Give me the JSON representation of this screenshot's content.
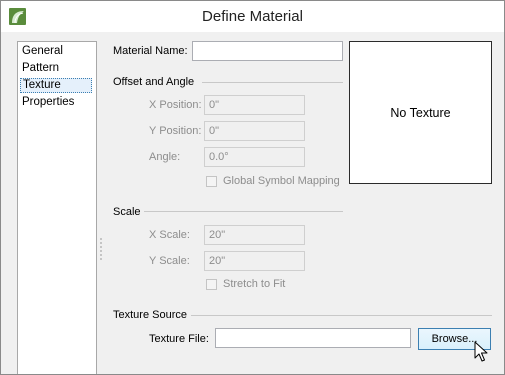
{
  "window": {
    "title": "Define Material",
    "app_icon": "app-logo-icon"
  },
  "nav": {
    "items": [
      {
        "label": "General",
        "selected": false
      },
      {
        "label": "Pattern",
        "selected": false
      },
      {
        "label": "Texture",
        "selected": true
      },
      {
        "label": "Properties",
        "selected": false
      }
    ]
  },
  "material_name": {
    "label": "Material Name:",
    "value": ""
  },
  "offset_angle": {
    "title": "Offset and Angle",
    "x_position": {
      "label": "X Position:",
      "value": "0\""
    },
    "y_position": {
      "label": "Y Position:",
      "value": "0\""
    },
    "angle": {
      "label": "Angle:",
      "value": "0.0°"
    },
    "global_symbol_mapping": {
      "label": "Global Symbol Mapping",
      "checked": false
    }
  },
  "scale": {
    "title": "Scale",
    "x_scale": {
      "label": "X Scale:",
      "value": "20\""
    },
    "y_scale": {
      "label": "Y Scale:",
      "value": "20\""
    },
    "stretch_to_fit": {
      "label": "Stretch to Fit",
      "checked": false
    }
  },
  "preview": {
    "text": "No Texture"
  },
  "texture_source": {
    "title": "Texture Source",
    "file_label": "Texture File:",
    "file_value": "",
    "browse_label": "Browse..."
  },
  "colors": {
    "selection_bg": "#e5f0fb",
    "button_border": "#3c7fb1",
    "app_icon_green": "#5a8c3c"
  },
  "cursor": {
    "icon": "mouse-pointer-icon"
  }
}
